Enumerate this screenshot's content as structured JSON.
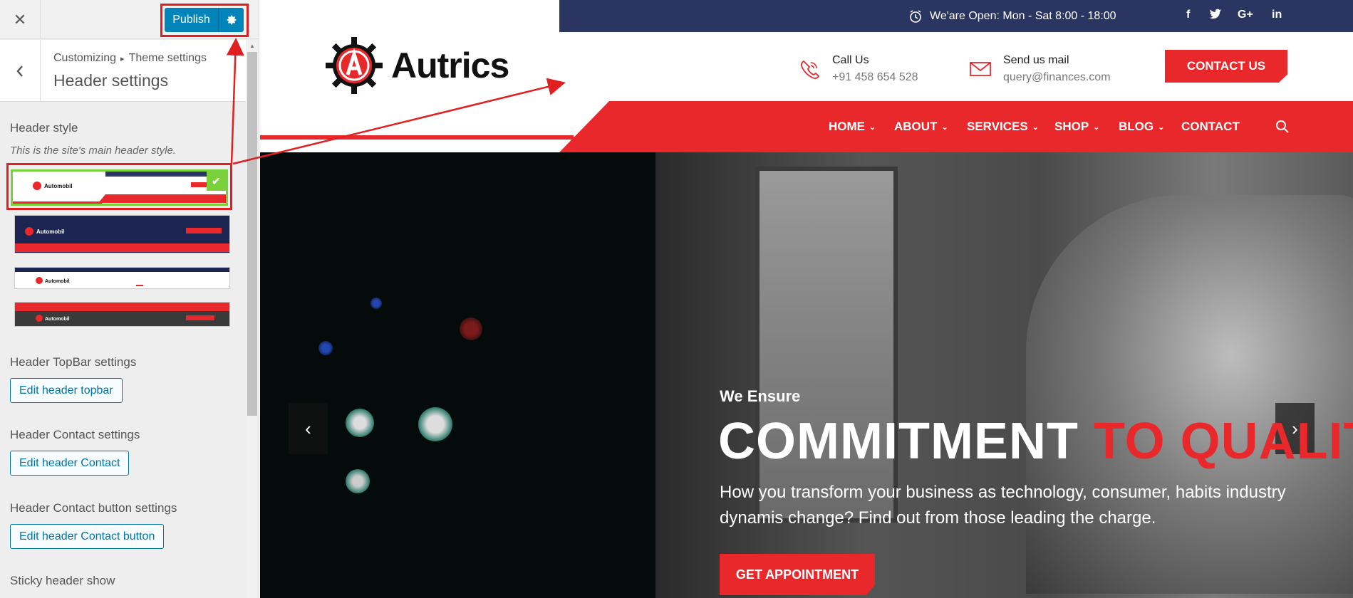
{
  "customizer": {
    "close_label": "✕",
    "publish_label": "Publish",
    "breadcrumb": {
      "root": "Customizing",
      "separator": "▸",
      "parent": "Theme settings"
    },
    "panel_title": "Header settings",
    "header_style": {
      "title": "Header style",
      "description": "This is the site's main header style.",
      "thumbnails": [
        {
          "logo": "Automobil",
          "variant": "default",
          "selected": true
        },
        {
          "logo": "Automobil",
          "variant": "dark",
          "selected": false
        },
        {
          "logo": "Automobil",
          "variant": "minimal",
          "selected": false
        },
        {
          "logo": "Automobil",
          "variant": "transparent",
          "selected": false
        }
      ]
    },
    "topbar_settings": {
      "title": "Header TopBar settings",
      "button": "Edit header topbar"
    },
    "contact_settings": {
      "title": "Header Contact settings",
      "button": "Edit header Contact"
    },
    "contact_button_settings": {
      "title": "Header Contact button settings",
      "button": "Edit header Contact button"
    },
    "sticky": {
      "title": "Sticky header show"
    }
  },
  "site": {
    "topbar": {
      "hours": "We'are Open: Mon - Sat 8:00 - 18:00",
      "social": [
        "facebook-icon",
        "twitter-icon",
        "google-plus-icon",
        "linkedin-icon"
      ],
      "social_glyphs": [
        "f",
        "🐦",
        "G+",
        "in"
      ]
    },
    "logo": "Autrics",
    "call": {
      "title": "Call Us",
      "value": "+91 458 654 528"
    },
    "mail": {
      "title": "Send us mail",
      "value": "query@finances.com"
    },
    "contact_button": "CONTACT US",
    "nav": [
      {
        "label": "HOME",
        "dropdown": true
      },
      {
        "label": "ABOUT",
        "dropdown": true
      },
      {
        "label": "SERVICES",
        "dropdown": true
      },
      {
        "label": "SHOP",
        "dropdown": true
      },
      {
        "label": "BLOG",
        "dropdown": true
      },
      {
        "label": "CONTACT",
        "dropdown": false
      }
    ],
    "hero": {
      "kicker": "We Ensure",
      "title_white": "COMMITMENT",
      "title_red": "TO QUALITY",
      "description": "How you transform your business as technology, consumer, habits industry dynamis change? Find out from those leading the charge.",
      "button": "GET APPOINTMENT",
      "prev": "‹",
      "next": "›"
    }
  },
  "colors": {
    "accent_red": "#e8282b",
    "topbar_navy": "#2b3561",
    "wp_blue": "#0085ba",
    "selected_green": "#7ad03a",
    "annotation_red": "#e02020"
  }
}
